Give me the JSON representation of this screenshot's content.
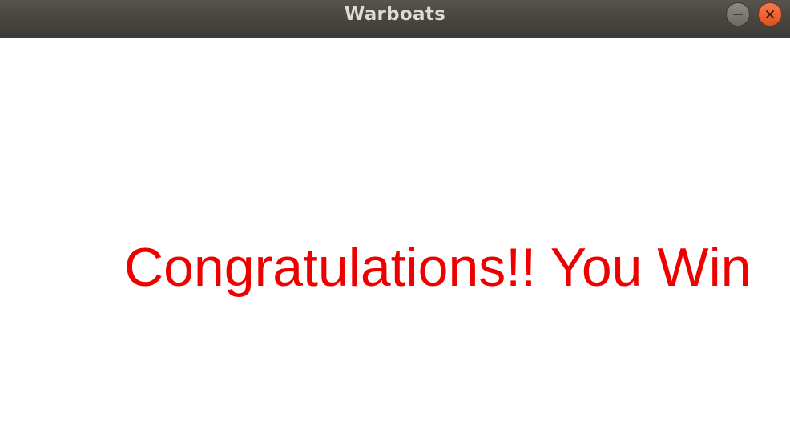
{
  "window": {
    "title": "Warboats"
  },
  "controls": {
    "minimize_icon": "minimize-icon",
    "close_icon": "close-icon"
  },
  "game": {
    "message": "Congratulations!! You Win",
    "message_color": "#ee0000",
    "background_color": "#ffffff"
  }
}
